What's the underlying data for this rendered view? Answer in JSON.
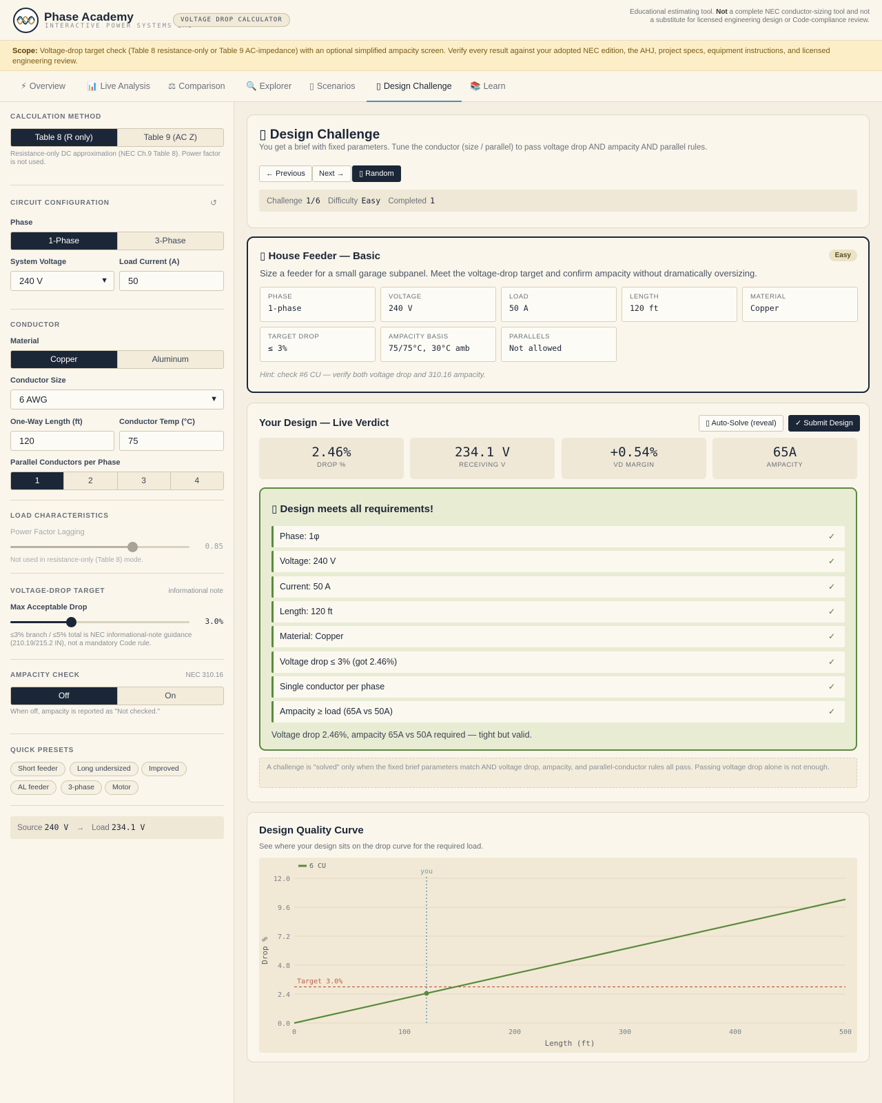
{
  "header": {
    "brand_title": "Phase Academy",
    "brand_subtitle": "INTERACTIVE POWER SYSTEMS LAB",
    "badge": "VOLTAGE DROP CALCULATOR",
    "note_prefix": "Educational estimating tool.",
    "note_bold": "Not",
    "note_suffix": "a complete NEC conductor-sizing tool and not a substitute for licensed engineering design or Code-compliance review."
  },
  "scope": {
    "label": "Scope:",
    "text": "Voltage-drop target check (Table 8 resistance-only or Table 9 AC-impedance) with an optional simplified ampacity screen. Verify every result against your adopted NEC edition, the AHJ, project specs, equipment instructions, and licensed engineering review."
  },
  "tabs": [
    {
      "icon": "⚡",
      "label": "Overview"
    },
    {
      "icon": "📊",
      "label": "Live Analysis"
    },
    {
      "icon": "⚖",
      "label": "Comparison"
    },
    {
      "icon": "🔍",
      "label": "Explorer"
    },
    {
      "icon": "▯",
      "label": "Scenarios"
    },
    {
      "icon": "▯",
      "label": "Design Challenge"
    },
    {
      "icon": "📚",
      "label": "Learn"
    }
  ],
  "sidebar": {
    "method": {
      "title": "CALCULATION METHOD",
      "options": [
        "Table 8 (R only)",
        "Table 9 (AC Z)"
      ],
      "help": "Resistance-only DC approximation (NEC Ch.9 Table 8). Power factor is not used."
    },
    "circuit": {
      "title": "CIRCUIT CONFIGURATION",
      "reset_icon": "↺",
      "phase_label": "Phase",
      "phase_options": [
        "1-Phase",
        "3-Phase"
      ],
      "voltage_label": "System Voltage",
      "voltage_value": "240 V",
      "current_label": "Load Current (A)",
      "current_value": "50"
    },
    "conductor": {
      "title": "CONDUCTOR",
      "material_label": "Material",
      "material_options": [
        "Copper",
        "Aluminum"
      ],
      "size_label": "Conductor Size",
      "size_value": "6 AWG",
      "length_label": "One-Way Length (ft)",
      "length_value": "120",
      "temp_label": "Conductor Temp (°C)",
      "temp_value": "75",
      "parallel_label": "Parallel Conductors per Phase",
      "parallel_options": [
        "1",
        "2",
        "3",
        "4"
      ]
    },
    "load": {
      "title": "LOAD CHARACTERISTICS",
      "pf_label": "Power Factor Lagging",
      "pf_value": "0.85",
      "pf_fraction": 0.68,
      "help": "Not used in resistance-only (Table 8) mode."
    },
    "target": {
      "title": "VOLTAGE-DROP TARGET",
      "aside": "informational note",
      "label": "Max Acceptable Drop",
      "value": "3.0%",
      "fraction": 0.34,
      "help": "≤3% branch / ≤5% total is NEC informational-note guidance (210.19/215.2 IN), not a mandatory Code rule."
    },
    "ampacity": {
      "title": "AMPACITY CHECK",
      "aside": "NEC 310.16",
      "options": [
        "Off",
        "On"
      ],
      "help": "When off, ampacity is reported as \"Not checked.\""
    },
    "presets": {
      "title": "QUICK PRESETS",
      "items": [
        "Short feeder",
        "Long undersized",
        "Improved",
        "AL feeder",
        "3-phase",
        "Motor"
      ]
    },
    "summary": {
      "source_label": "Source",
      "source_value": "240 V",
      "arrow": "→",
      "load_label": "Load",
      "load_value": "234.1 V"
    }
  },
  "challenge": {
    "icon": "▯",
    "title": "Design Challenge",
    "subtitle": "You get a brief with fixed parameters. Tune the conductor (size / parallel) to pass voltage drop AND ampacity AND parallel rules.",
    "prev_label": "← Previous",
    "next_label": "Next →",
    "random_label": "▯ Random",
    "challenge_label": "Challenge",
    "challenge_value": "1/6",
    "difficulty_label": "Difficulty",
    "difficulty_value": "Easy",
    "completed_label": "Completed",
    "completed_value": "1"
  },
  "brief": {
    "icon": "▯",
    "title": "House Feeder — Basic",
    "badge": "Easy",
    "description": "Size a feeder for a small garage subpanel. Meet the voltage-drop target and confirm ampacity without dramatically oversizing.",
    "params": [
      {
        "key": "PHASE",
        "value": "1-phase"
      },
      {
        "key": "VOLTAGE",
        "value": "240 V"
      },
      {
        "key": "LOAD",
        "value": "50 A"
      },
      {
        "key": "LENGTH",
        "value": "120 ft"
      },
      {
        "key": "MATERIAL",
        "value": "Copper"
      },
      {
        "key": "TARGET DROP",
        "value": "≤ 3%"
      },
      {
        "key": "AMPACITY BASIS",
        "value": "75/75°C, 30°C amb"
      },
      {
        "key": "PARALLELS",
        "value": "Not allowed"
      }
    ],
    "hint": "Hint: check #6 CU — verify both voltage drop and 310.16 ampacity."
  },
  "design": {
    "title": "Your Design — Live Verdict",
    "autosolve_label": "▯ Auto-Solve (reveal)",
    "submit_label": "✓ Submit Design",
    "metrics": [
      {
        "value": "2.46%",
        "label": "DROP %"
      },
      {
        "value": "234.1 V",
        "label": "RECEIVING V"
      },
      {
        "value": "+0.54%",
        "label": "VD MARGIN"
      },
      {
        "value": "65A",
        "label": "AMPACITY"
      }
    ],
    "verdict_icon": "▯",
    "verdict_title": "Design meets all requirements!",
    "checks": [
      "Phase: 1φ",
      "Voltage: 240 V",
      "Current: 50 A",
      "Length: 120 ft",
      "Material: Copper",
      "Voltage drop ≤ 3% (got 2.46%)",
      "Single conductor per phase",
      "Ampacity ≥ load (65A vs 50A)"
    ],
    "tick": "✓",
    "summary": "Voltage drop 2.46%, ampacity 65A vs 50A required — tight but valid.",
    "note": "A challenge is \"solved\" only when the fixed brief parameters match AND voltage drop, ampacity, and parallel-conductor rules all pass. Passing voltage drop alone is not enough."
  },
  "curve": {
    "title": "Design Quality Curve",
    "subtitle": "See where your design sits on the drop curve for the required load."
  },
  "colors": {
    "navy": "#1b2637",
    "green": "#5a8a3d",
    "target_red": "#c0604a",
    "marker_blue": "#6a9cc0"
  },
  "chart_data": {
    "type": "line",
    "xlabel": "Length (ft)",
    "ylabel": "Drop %",
    "xlim": [
      0,
      500
    ],
    "ylim": [
      0,
      12
    ],
    "xticks": [
      0,
      100,
      200,
      300,
      400,
      500
    ],
    "yticks": [
      "0.0",
      "2.4",
      "4.8",
      "7.2",
      "9.6",
      "12.0"
    ],
    "series": [
      {
        "name": "6 CU",
        "x": [
          0,
          500
        ],
        "y": [
          0,
          10.25
        ]
      }
    ],
    "target": {
      "label": "Target 3.0%",
      "y": 3.0
    },
    "marker": {
      "label": "you",
      "x": 120,
      "y": 2.46
    },
    "legend": "top-left",
    "grid": true
  }
}
